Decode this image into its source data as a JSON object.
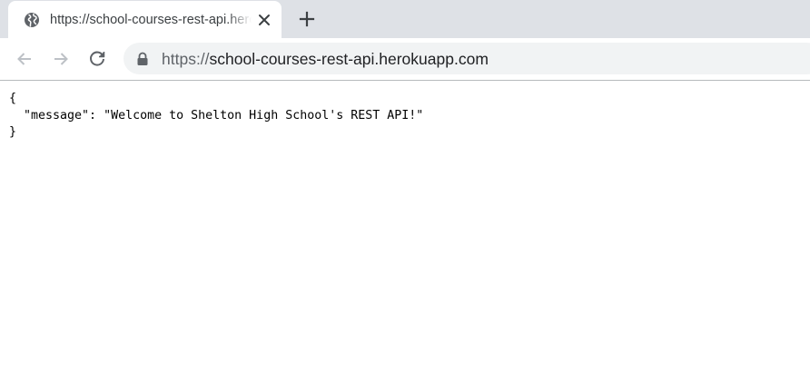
{
  "tab": {
    "title": "https://school-courses-rest-api.herokuapp.com",
    "favicon": "globe-icon"
  },
  "toolbar": {
    "back": "arrow-left-icon",
    "forward": "arrow-right-icon",
    "reload": "reload-icon"
  },
  "omnibox": {
    "scheme": "https://",
    "host": "school-courses-rest-api.herokuapp.com"
  },
  "page": {
    "open_brace": "{",
    "line": "  \"message\": \"Welcome to Shelton High School's REST API!\"",
    "close_brace": "}"
  }
}
